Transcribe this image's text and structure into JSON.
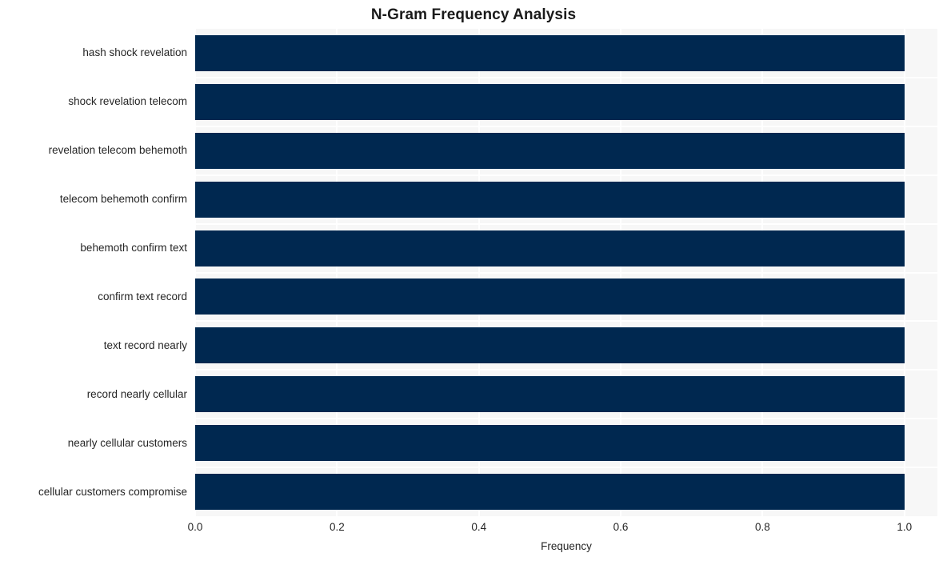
{
  "chart_data": {
    "type": "bar",
    "orientation": "horizontal",
    "title": "N-Gram Frequency Analysis",
    "xlabel": "Frequency",
    "ylabel": "",
    "categories": [
      "hash shock revelation",
      "shock revelation telecom",
      "revelation telecom behemoth",
      "telecom behemoth confirm",
      "behemoth confirm text",
      "confirm text record",
      "text record nearly",
      "record nearly cellular",
      "nearly cellular customers",
      "cellular customers compromise"
    ],
    "values": [
      1.0,
      1.0,
      1.0,
      1.0,
      1.0,
      1.0,
      1.0,
      1.0,
      1.0,
      1.0
    ],
    "xticks": [
      "0.0",
      "0.2",
      "0.4",
      "0.6",
      "0.8",
      "1.0"
    ],
    "xtick_values": [
      0.0,
      0.2,
      0.4,
      0.6,
      0.8,
      1.0
    ],
    "xlim": [
      0.0,
      1.0465
    ],
    "grid": true,
    "legend": null,
    "bar_color": "#002850",
    "plot_background": "#f7f7f7",
    "grid_color": "#ffffff",
    "text_color": "#262626",
    "title_color": "#1a1a1a"
  }
}
